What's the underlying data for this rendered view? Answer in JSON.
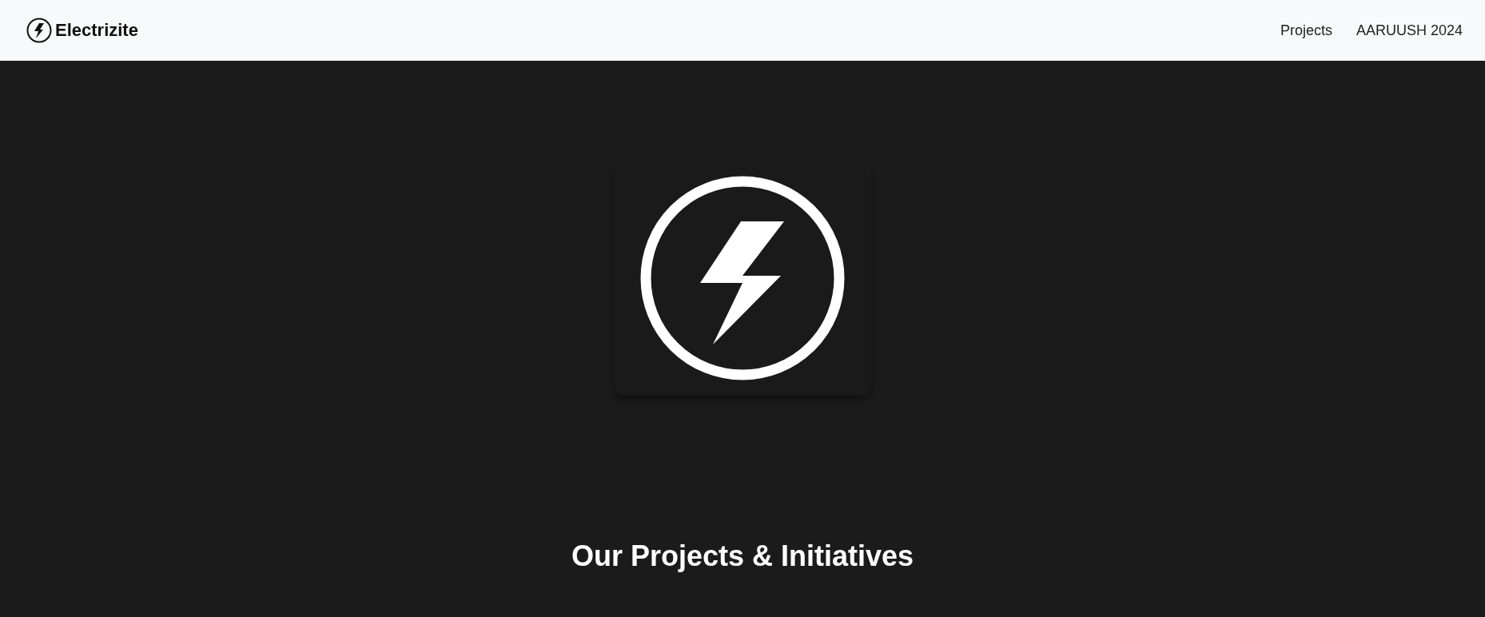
{
  "navbar": {
    "brand": "Electrizite",
    "links": [
      {
        "label": "Projects"
      },
      {
        "label": "AARUUSH 2024"
      }
    ]
  },
  "hero": {
    "heading": "Our Projects & Initiatives"
  }
}
